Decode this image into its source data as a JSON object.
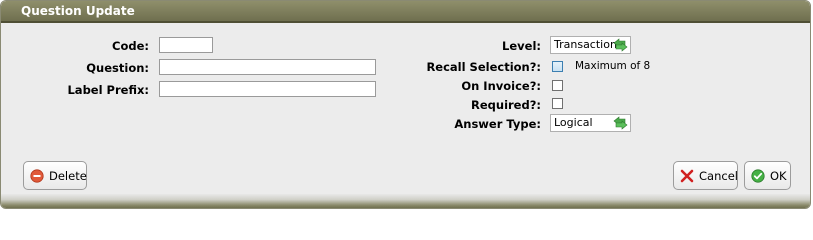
{
  "dialog": {
    "title": "Question Update"
  },
  "fields": {
    "code": {
      "label": "Code:",
      "value": ""
    },
    "question": {
      "label": "Question:",
      "value": ""
    },
    "label_prefix": {
      "label": "Label Prefix:",
      "value": ""
    },
    "level": {
      "label": "Level:",
      "value": "Transaction"
    },
    "recall_selection": {
      "label": "Recall Selection?:",
      "checked": false,
      "note": "Maximum of 8"
    },
    "on_invoice": {
      "label": "On Invoice?:",
      "checked": false
    },
    "required": {
      "label": "Required?:",
      "checked": false
    },
    "answer_type": {
      "label": "Answer Type:",
      "value": "Logical"
    }
  },
  "buttons": {
    "delete": "Delete",
    "cancel": "Cancel",
    "ok": "OK"
  },
  "colors": {
    "titlebar": "#7f7f5c",
    "body": "#ececec",
    "delete_icon": "#d9472b",
    "cancel_icon": "#d02020",
    "ok_icon": "#3aa53a",
    "select_arrows": "#3f9a3f"
  },
  "icons": {
    "delete": "minus-circle-icon",
    "cancel": "x-icon",
    "ok": "check-circle-icon",
    "select": "up-down-arrows-icon"
  }
}
